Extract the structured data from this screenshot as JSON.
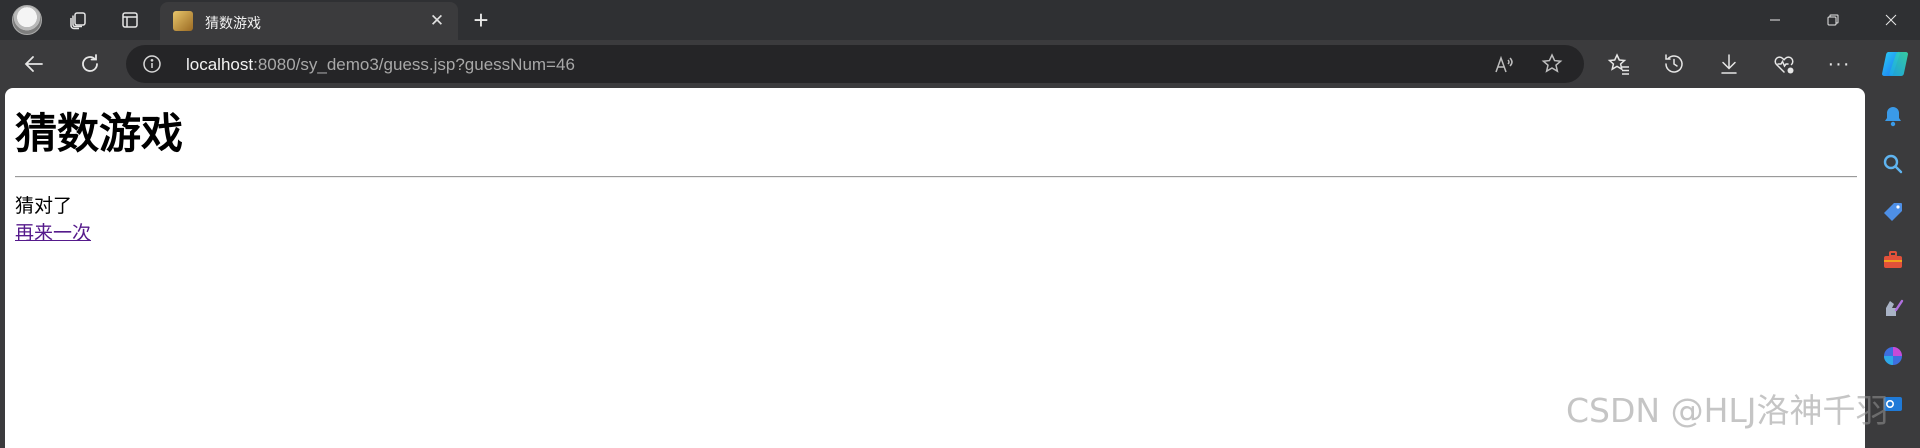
{
  "browser": {
    "tab": {
      "title": "猜数游戏"
    },
    "address": {
      "host": "localhost",
      "path": ":8080/sy_demo3/guess.jsp?guessNum=46"
    },
    "icons": {
      "profile": "profile-avatar-icon",
      "collections": "collections-icon",
      "tab_actions": "tab-actions-icon",
      "close_tab": "close-icon",
      "new_tab": "plus-icon",
      "back": "back-arrow-icon",
      "refresh": "refresh-icon",
      "info": "info-icon",
      "read_aloud": "read-aloud-icon",
      "favorite": "star-icon",
      "favorites": "favorites-icon",
      "history": "history-icon",
      "downloads": "download-icon",
      "browser_essentials": "heart-pulse-icon",
      "more": "more-icon",
      "copilot": "copilot-icon"
    }
  },
  "sidebar": {
    "items": [
      "bell-icon",
      "search-icon",
      "shopping-tag-icon",
      "tools-icon",
      "games-icon",
      "office-icon",
      "outlook-icon"
    ]
  },
  "page": {
    "heading": "猜数游戏",
    "result": "猜对了",
    "again_link": "再来一次"
  },
  "watermark": "CSDN @HLJ洛神千羽",
  "colors": {
    "chrome": "#3b3b3d",
    "tabstrip": "#2f3033",
    "addressbar": "#252527",
    "visited_link": "#551a8b"
  }
}
